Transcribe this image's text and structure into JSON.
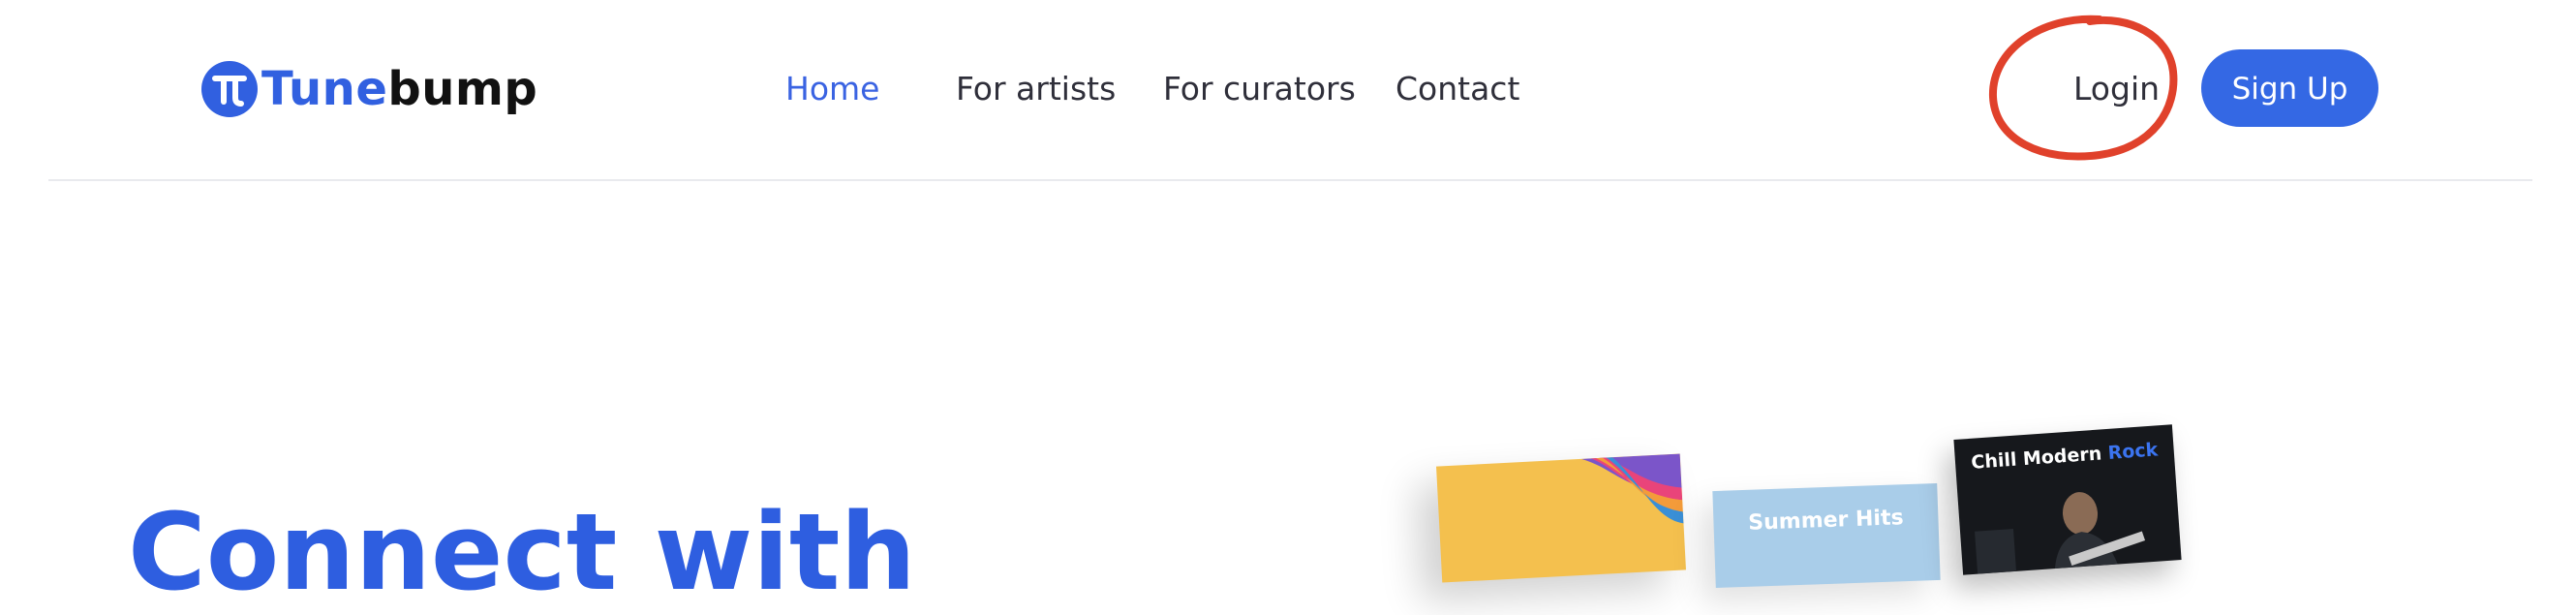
{
  "brand": {
    "name_part1": "Tune",
    "name_part2": "bump",
    "primary_color": "#3160e0"
  },
  "nav": {
    "items": [
      {
        "label": "Home",
        "active": true
      },
      {
        "label": "For artists",
        "active": false
      },
      {
        "label": "For curators",
        "active": false
      },
      {
        "label": "Contact",
        "active": false
      }
    ]
  },
  "auth": {
    "login_label": "Login",
    "signup_label": "Sign Up",
    "annotation_color": "#e0412b"
  },
  "hero": {
    "title": "Connect with"
  },
  "playlist_cards": [
    {
      "title": ""
    },
    {
      "title": "Summer Hits"
    },
    {
      "title_main": "Chill Modern ",
      "title_accent": "Rock"
    }
  ]
}
